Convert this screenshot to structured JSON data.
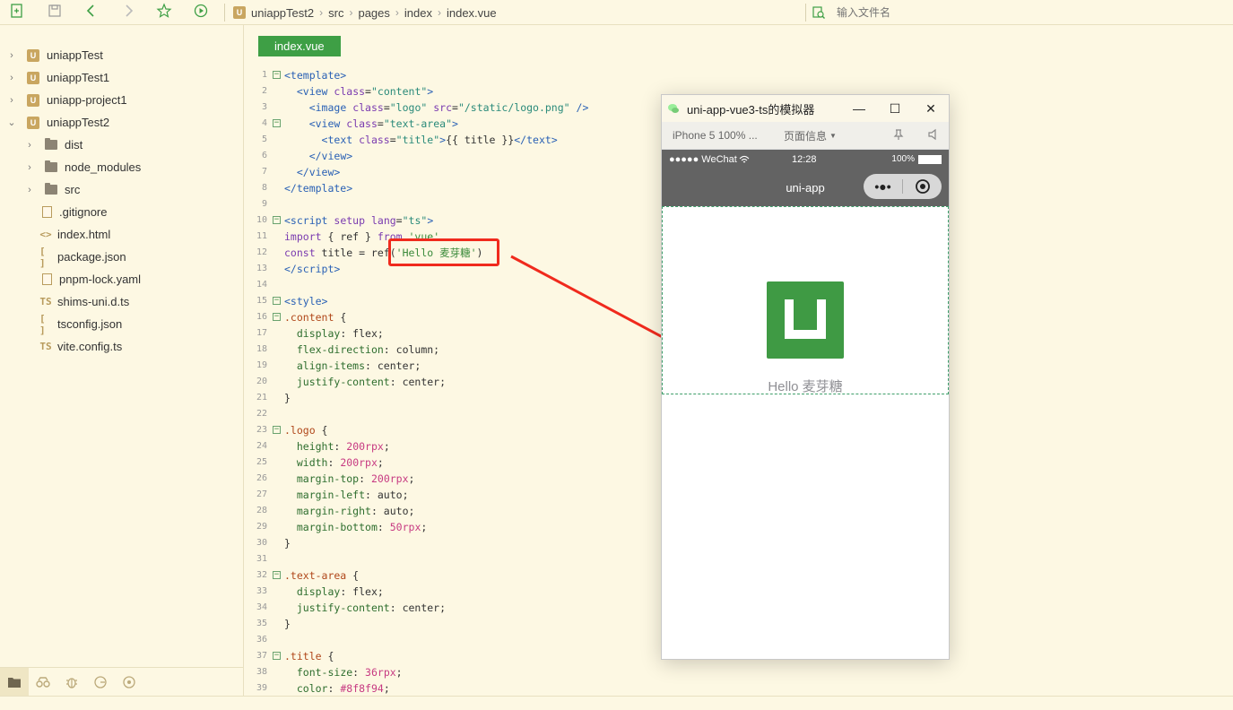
{
  "toolbar": {
    "buttons": [
      "new-file",
      "save",
      "back",
      "forward",
      "favorite",
      "run"
    ]
  },
  "breadcrumb": {
    "items": [
      "uniappTest2",
      "src",
      "pages",
      "index",
      "index.vue"
    ]
  },
  "file_search": {
    "placeholder": "输入文件名"
  },
  "sidebar": {
    "items": [
      {
        "label": "uniappTest",
        "type": "project",
        "expanded": false
      },
      {
        "label": "uniappTest1",
        "type": "project",
        "expanded": false
      },
      {
        "label": "uniapp-project1",
        "type": "project",
        "expanded": false
      },
      {
        "label": "uniappTest2",
        "type": "project",
        "expanded": true
      },
      {
        "label": "dist",
        "type": "folder",
        "expanded": false
      },
      {
        "label": "node_modules",
        "type": "folder",
        "expanded": false
      },
      {
        "label": "src",
        "type": "folder",
        "expanded": false
      },
      {
        "label": ".gitignore",
        "type": "file",
        "icon": "doc"
      },
      {
        "label": "index.html",
        "type": "file",
        "icon": "<>"
      },
      {
        "label": "package.json",
        "type": "file",
        "icon": "[ ]"
      },
      {
        "label": "pnpm-lock.yaml",
        "type": "file",
        "icon": "doc"
      },
      {
        "label": "shims-uni.d.ts",
        "type": "file",
        "icon": "TS"
      },
      {
        "label": "tsconfig.json",
        "type": "file",
        "icon": "[ ]"
      },
      {
        "label": "vite.config.ts",
        "type": "file",
        "icon": "TS"
      }
    ]
  },
  "editor": {
    "tab_label": "index.vue",
    "line_numbers": [
      "1",
      "2",
      "3",
      "4",
      "5",
      "6",
      "7",
      "8",
      "9",
      "10",
      "11",
      "12",
      "13",
      "14",
      "15",
      "16",
      "17",
      "18",
      "19",
      "20",
      "21",
      "22",
      "23",
      "24",
      "25",
      "26",
      "27",
      "28",
      "29",
      "30",
      "31",
      "32",
      "33",
      "34",
      "35",
      "36",
      "37",
      "38",
      "39"
    ]
  },
  "simulator": {
    "title": "uni-app-vue3-ts的模拟器",
    "device": "iPhone 5 100% ...",
    "page_info": "页面信息",
    "status_carrier": "●●●●● WeChat",
    "status_time": "12:28",
    "status_battery": "100%",
    "nav_title": "uni-app",
    "content_text": "Hello 麦芽糖"
  },
  "colors": {
    "accent": "#3e9f45",
    "background": "#fdf8e3",
    "highlight": "#f02a1d",
    "title_text": "#8f8f94"
  }
}
